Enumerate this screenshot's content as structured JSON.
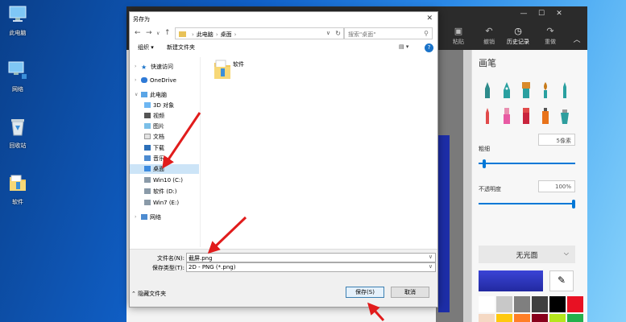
{
  "desktop": {
    "icons": [
      {
        "label": "此电脑",
        "icon": "computer-icon"
      },
      {
        "label": "网络",
        "icon": "network-icon"
      },
      {
        "label": "回收站",
        "icon": "recycle-bin-icon"
      },
      {
        "label": "软件",
        "icon": "folder-icon"
      }
    ]
  },
  "paint": {
    "toolbar": {
      "paste": "粘贴",
      "undo": "撤销",
      "history": "历史记录",
      "redo": "重做"
    },
    "panel": {
      "title": "画笔",
      "thickness_label": "粗细",
      "thickness_value": "5像素",
      "thickness_level": 0.04,
      "opacity_label": "不透明度",
      "opacity_value": "100%",
      "opacity_level": 1.0,
      "finish": "无光面"
    },
    "colors": [
      "#ffffff",
      "#c8c8c8",
      "#7f7f7f",
      "#3f3f3f",
      "#000000",
      "#e81123"
    ]
  },
  "dialog": {
    "title": "另存为",
    "address": [
      "此电脑",
      "桌面"
    ],
    "search_placeholder": "搜索\"桌面\"",
    "organize": "组织 ▾",
    "new_folder": "新建文件夹",
    "tree": [
      {
        "label": "快速访问",
        "icon": "star-icon"
      },
      {
        "label": "OneDrive",
        "icon": "cloud-icon"
      },
      {
        "label": "此电脑",
        "icon": "computer-icon"
      },
      {
        "label": "3D 对象",
        "icon": "cube-icon"
      },
      {
        "label": "视频",
        "icon": "video-icon"
      },
      {
        "label": "图片",
        "icon": "picture-icon"
      },
      {
        "label": "文档",
        "icon": "document-icon"
      },
      {
        "label": "下载",
        "icon": "download-icon"
      },
      {
        "label": "音乐",
        "icon": "music-icon"
      },
      {
        "label": "桌面",
        "icon": "desktop-icon"
      },
      {
        "label": "Win10 (C:)",
        "icon": "drive-icon"
      },
      {
        "label": "软件 (D:)",
        "icon": "drive-icon"
      },
      {
        "label": "Win7 (E:)",
        "icon": "drive-icon"
      },
      {
        "label": "网络",
        "icon": "network-icon"
      }
    ],
    "files": [
      {
        "name": "软件",
        "icon": "folder-icon"
      }
    ],
    "filename_label": "文件名(N):",
    "filename_value": "截屏.png",
    "filetype_label": "保存类型(T):",
    "filetype_value": "2D - PNG (*.png)",
    "hide_folders": "隐藏文件夹",
    "save": "保存(S)",
    "cancel": "取消"
  }
}
